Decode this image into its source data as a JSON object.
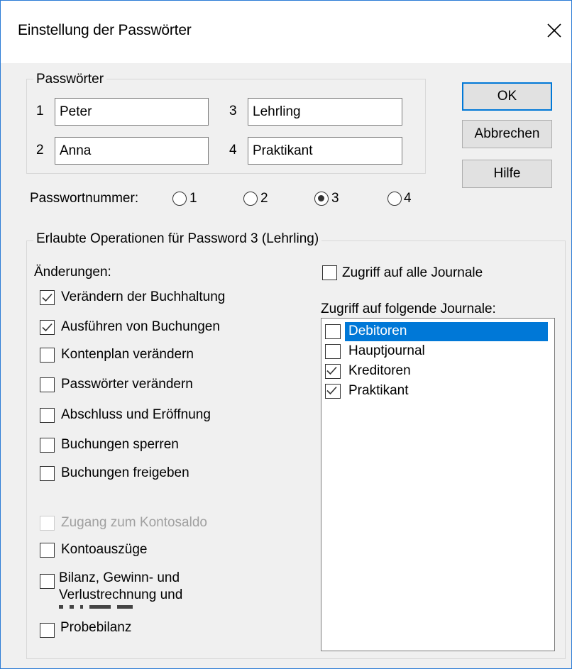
{
  "dialog": {
    "title": "Einstellung der Passwörter",
    "close_icon": "close-icon"
  },
  "passwords_group": {
    "label": "Passwörter",
    "items": [
      {
        "num": "1",
        "value": "Peter"
      },
      {
        "num": "2",
        "value": "Anna"
      },
      {
        "num": "3",
        "value": "Lehrling"
      },
      {
        "num": "4",
        "value": "Praktikant"
      }
    ]
  },
  "buttons": {
    "ok": "OK",
    "cancel": "Abbrechen",
    "help": "Hilfe"
  },
  "password_number": {
    "label": "Passwortnummer:",
    "options": [
      "1",
      "2",
      "3",
      "4"
    ],
    "selected": "3"
  },
  "operations_group": {
    "label": "Erlaubte Operationen für Password 3  (Lehrling)",
    "changes_label": "Änderungen:",
    "checkboxes": [
      {
        "label": "Verändern der Buchhaltung",
        "checked": true,
        "disabled": false
      },
      {
        "label": "Ausführen von Buchungen",
        "checked": true,
        "disabled": false
      },
      {
        "label": "Kontenplan verändern",
        "checked": false,
        "disabled": false
      },
      {
        "label": "Passwörter verändern",
        "checked": false,
        "disabled": false
      },
      {
        "label": "Abschluss und Eröffnung",
        "checked": false,
        "disabled": false
      },
      {
        "label": "Buchungen sperren",
        "checked": false,
        "disabled": false
      },
      {
        "label": "Buchungen freigeben",
        "checked": false,
        "disabled": false
      },
      {
        "label": "Zugang zum Kontosaldo",
        "checked": false,
        "disabled": true
      },
      {
        "label": "Kontoauszüge",
        "checked": false,
        "disabled": false
      },
      {
        "label_line1": "Bilanz, Gewinn- und",
        "label_line2": "Verlustrechnung und",
        "checked": false,
        "disabled": false
      },
      {
        "label": "Probebilanz",
        "checked": false,
        "disabled": false
      }
    ],
    "all_journals": {
      "label": "Zugriff auf alle Journale",
      "checked": false
    },
    "journals_label": "Zugriff auf folgende Journale:",
    "journals": [
      {
        "label": "Debitoren",
        "checked": false,
        "selected": true
      },
      {
        "label": "Hauptjournal",
        "checked": false,
        "selected": false
      },
      {
        "label": "Kreditoren",
        "checked": true,
        "selected": false
      },
      {
        "label": "Praktikant",
        "checked": true,
        "selected": false
      }
    ]
  },
  "colors": {
    "accent": "#0078d7",
    "window_border": "#2b7bd6",
    "dialog_bg": "#f0f0f0"
  }
}
